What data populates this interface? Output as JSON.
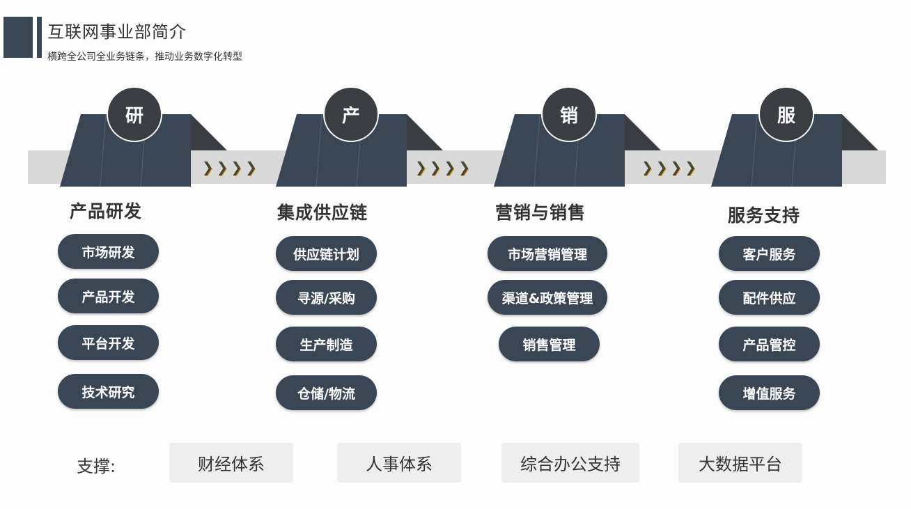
{
  "header": {
    "title": "互联网事业部简介",
    "subtitle": "横跨全公司全业务链条，推动业务数字化转型"
  },
  "arrow_glyph": "❯",
  "stages": [
    {
      "badge": "研",
      "title": "产品研发",
      "items": [
        "市场研发",
        "产品开发",
        "平台开发",
        "技术研究"
      ]
    },
    {
      "badge": "产",
      "title": "集成供应链",
      "items": [
        "供应链计划",
        "寻源/采购",
        "生产制造",
        "仓储/物流"
      ]
    },
    {
      "badge": "销",
      "title": "营销与销售",
      "items": [
        "市场营销管理",
        "渠道&政策管理",
        "销售管理"
      ]
    },
    {
      "badge": "服",
      "title": "服务支持",
      "items": [
        "客户服务",
        "配件供应",
        "产品管控",
        "增值服务"
      ]
    }
  ],
  "support": {
    "label": "支撑:",
    "items": [
      "财经体系",
      "人事体系",
      "综合办公支持",
      "大数据平台"
    ]
  },
  "colors": {
    "dark_slate": "#3b4654",
    "badge_dark": "#3a3d42",
    "band_gray": "#d8d8d8",
    "arrow_gold": "#d4a828"
  }
}
